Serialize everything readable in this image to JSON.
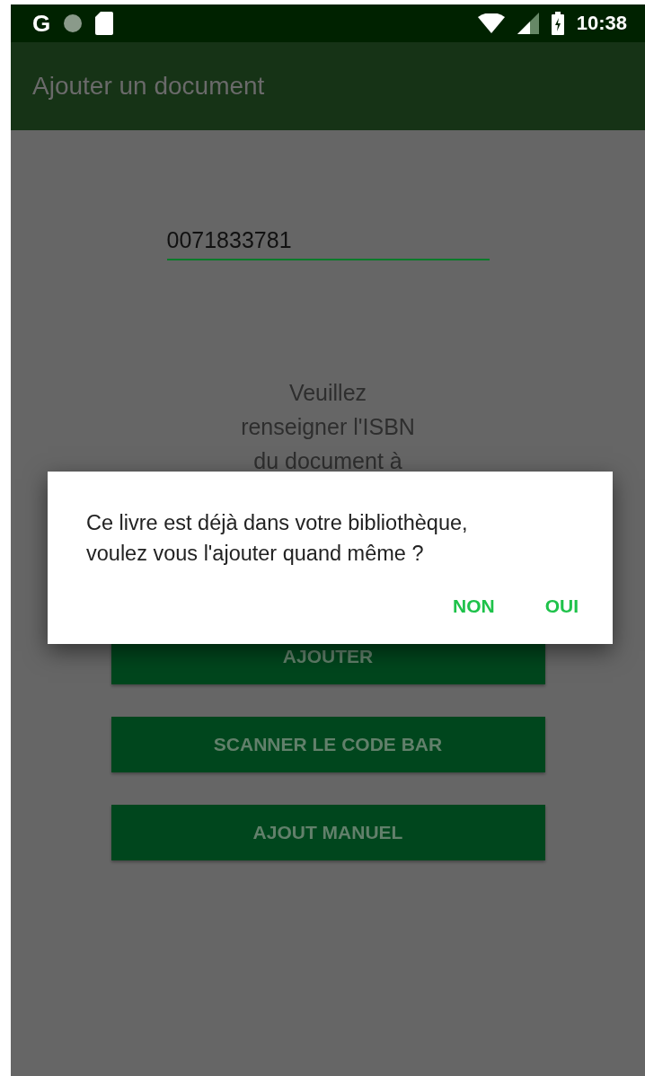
{
  "status_bar": {
    "left_glyph": "G",
    "time": "10:38"
  },
  "app_bar": {
    "title": "Ajouter un document"
  },
  "isbn_field": {
    "value": "0071833781",
    "focused": true
  },
  "hint_lines": [
    "Veuillez",
    "renseigner l'ISBN",
    "du document à"
  ],
  "buttons": [
    "AJOUTER",
    "SCANNER LE CODE BAR",
    "AJOUT MANUEL"
  ],
  "dialog": {
    "message": "Ce livre est déjà dans votre bibliothèque, voulez vous l'ajouter quand même ?",
    "actions": [
      "NON",
      "OUI"
    ]
  }
}
